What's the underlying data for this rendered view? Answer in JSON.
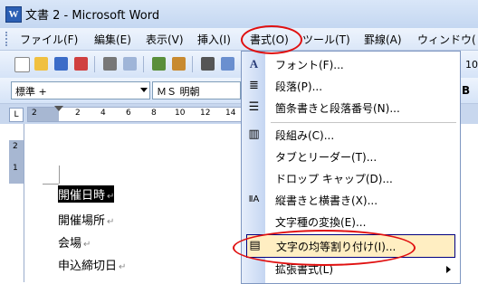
{
  "window": {
    "title": "文書 2 - Microsoft Word",
    "app_icon_letter": "W"
  },
  "menubar": {
    "items": [
      {
        "label": "ファイル(F)"
      },
      {
        "label": "編集(E)"
      },
      {
        "label": "表示(V)"
      },
      {
        "label": "挿入(I)"
      },
      {
        "label": "書式(O)"
      },
      {
        "label": "ツール(T)"
      },
      {
        "label": "罫線(A)"
      },
      {
        "label": "ウィンドウ("
      }
    ]
  },
  "toolbar": {
    "zoom_partial": "10"
  },
  "formatting": {
    "style_value": "標準 +",
    "font_value": "ＭＳ 明朝",
    "bold_label": "B"
  },
  "ruler": {
    "corner": "L",
    "numbers": [
      "2",
      "2",
      "4",
      "6",
      "8",
      "10",
      "12",
      "14"
    ]
  },
  "vruler": {
    "numbers": [
      "2",
      "1"
    ]
  },
  "document": {
    "lines": [
      "開催日時",
      "開催場所",
      "会場",
      "申込締切日"
    ],
    "para_mark": "↵"
  },
  "format_menu": {
    "items": [
      {
        "label": "フォント(F)...",
        "icon": "font-icon"
      },
      {
        "label": "段落(P)...",
        "icon": "paragraph-icon"
      },
      {
        "label": "箇条書きと段落番号(N)...",
        "icon": "bullets-icon"
      },
      {
        "label": "段組み(C)...",
        "icon": "columns-icon"
      },
      {
        "label": "タブとリーダー(T)...",
        "icon": ""
      },
      {
        "label": "ドロップ キャップ(D)...",
        "icon": ""
      },
      {
        "label": "縦書きと横書き(X)...",
        "icon": "text-direction-icon"
      },
      {
        "label": "文字種の変換(E)...",
        "icon": ""
      },
      {
        "label": "文字の均等割り付け(I)...",
        "icon": "distribute-icon",
        "highlighted": true
      },
      {
        "label": "拡張書式(L)",
        "icon": "",
        "submenu": true
      }
    ]
  },
  "colors": {
    "highlight": "#ffeec2",
    "annotation": "#e01010",
    "menubar": "#dbe7f8"
  }
}
